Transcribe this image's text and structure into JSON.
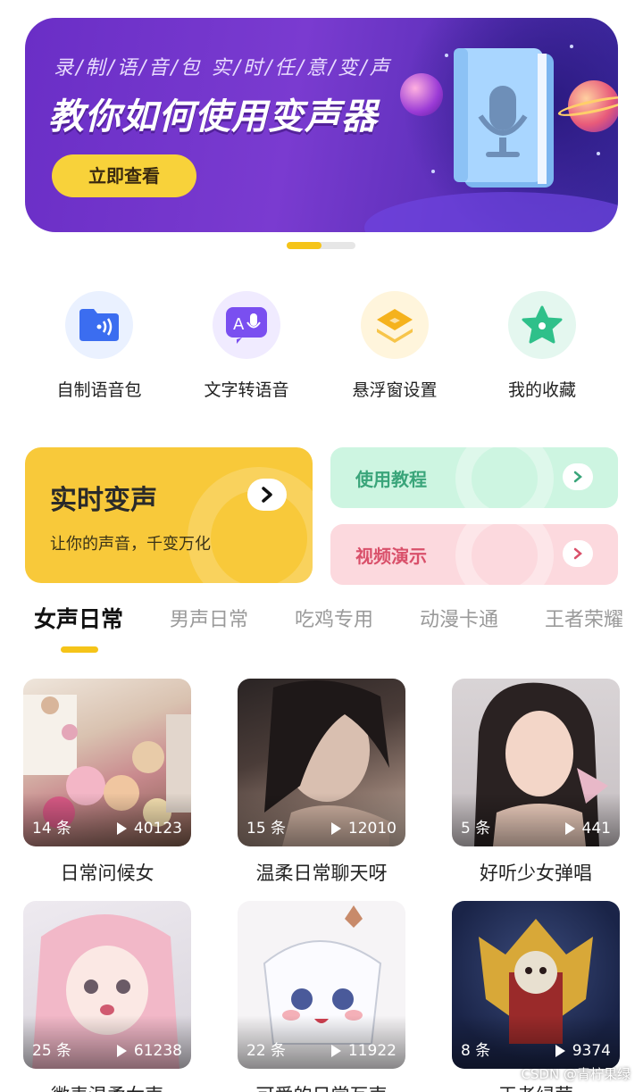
{
  "banner": {
    "subtitle": "录/制/语/音/包    实/时/任/意/变/声",
    "headline": "教你如何使用变声器",
    "cta_label": "立即查看"
  },
  "pager": {
    "total": 2,
    "active_index": 0
  },
  "quick_actions": [
    {
      "label": "自制语音包",
      "icon": "voice-folder-icon",
      "bg": "#eaf1ff",
      "color": "#3b6df0"
    },
    {
      "label": "文字转语音",
      "icon": "text-to-speech-icon",
      "bg": "#f0ebff",
      "color": "#7a4ff0"
    },
    {
      "label": "悬浮窗设置",
      "icon": "layers-icon",
      "bg": "#fff5dc",
      "color": "#f5b21d"
    },
    {
      "label": "我的收藏",
      "icon": "star-icon",
      "bg": "#e4f7ef",
      "color": "#2fc08a"
    }
  ],
  "feature_cards": {
    "realtime": {
      "title": "实时变声",
      "desc": "让你的声音，千变万化",
      "color": "#f8c93a"
    },
    "tutorial": {
      "title": "使用教程",
      "bg": "#cdf5e1",
      "color": "#3aa57a"
    },
    "video": {
      "title": "视频演示",
      "bg": "#fcd9de",
      "color": "#d9506a"
    }
  },
  "tabs": [
    "女声日常",
    "男声日常",
    "吃鸡专用",
    "动漫卡通",
    "王者荣耀"
  ],
  "active_tab": 0,
  "voice_packs": [
    {
      "name": "日常问候女",
      "count": "14 条",
      "plays": "40123",
      "thumb": "room-plush-toys"
    },
    {
      "name": "温柔日常聊天呀",
      "count": "15 条",
      "plays": "12010",
      "thumb": "girl-dark-hair"
    },
    {
      "name": "好听少女弹唱",
      "count": "5 条",
      "plays": "441",
      "thumb": "girl-portrait"
    },
    {
      "name": "微表温柔女声",
      "count": "25 条",
      "plays": "61238",
      "thumb": "anime-pink-hair"
    },
    {
      "name": "可爱的日常互声",
      "count": "22 条",
      "plays": "11922",
      "thumb": "anime-white-hair"
    },
    {
      "name": "王者绿荣",
      "count": "8 条",
      "plays": "9374",
      "thumb": "honor-emblem"
    }
  ],
  "watermark": "CSDN @青柠果绿"
}
